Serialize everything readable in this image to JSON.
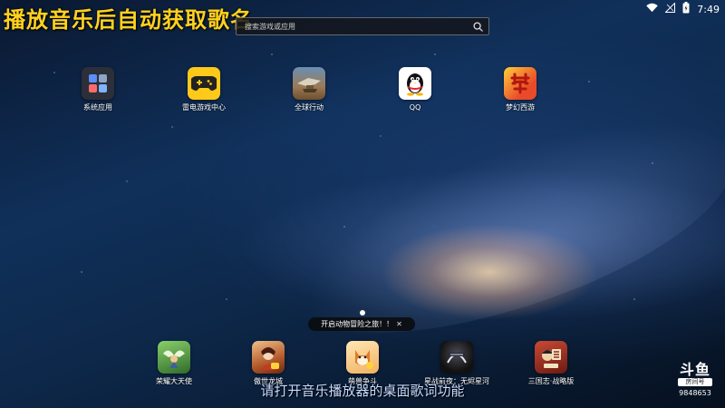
{
  "overlay_title": "播放音乐后自动获取歌名",
  "search": {
    "placeholder": "搜索游戏或应用"
  },
  "status_bar": {
    "time": "7:49"
  },
  "top_apps": [
    {
      "label": "系统应用",
      "icon": "system-apps-folder-icon",
      "color": "#2b2f3a"
    },
    {
      "label": "雷电游戏中心",
      "icon": "gamepad-icon",
      "color": "#ffc91a"
    },
    {
      "label": "全球行动",
      "icon": "global-ops-game-icon",
      "color": "#9a7a56"
    },
    {
      "label": "QQ",
      "icon": "qq-penguin-icon",
      "color": "#ffffff"
    },
    {
      "label": "梦幻西游",
      "icon": "menghuan-xiyou-icon",
      "color": "#e84a2a"
    }
  ],
  "toast": {
    "text": "开启动物冒险之旅！！"
  },
  "dock_apps": [
    {
      "label": "荣耀大天使",
      "icon": "archangel-game-icon",
      "color": "#4b8d3a"
    },
    {
      "label": "傲世龙城",
      "icon": "dragon-city-game-icon",
      "color": "#b45b2c"
    },
    {
      "label": "萌兽争斗",
      "icon": "cute-beast-game-icon",
      "color": "#f0b060"
    },
    {
      "label": "星战前夜：无烬星河",
      "icon": "eve-echoes-game-icon",
      "color": "#1c1c22"
    },
    {
      "label": "三国志·战略版",
      "icon": "three-kingdoms-game-icon",
      "color": "#8d2a20"
    }
  ],
  "subtitle": "请打开音乐播放器的桌面歌词功能",
  "watermark": {
    "logo": "斗鱼",
    "sub": "房间号",
    "room": "9848653"
  }
}
